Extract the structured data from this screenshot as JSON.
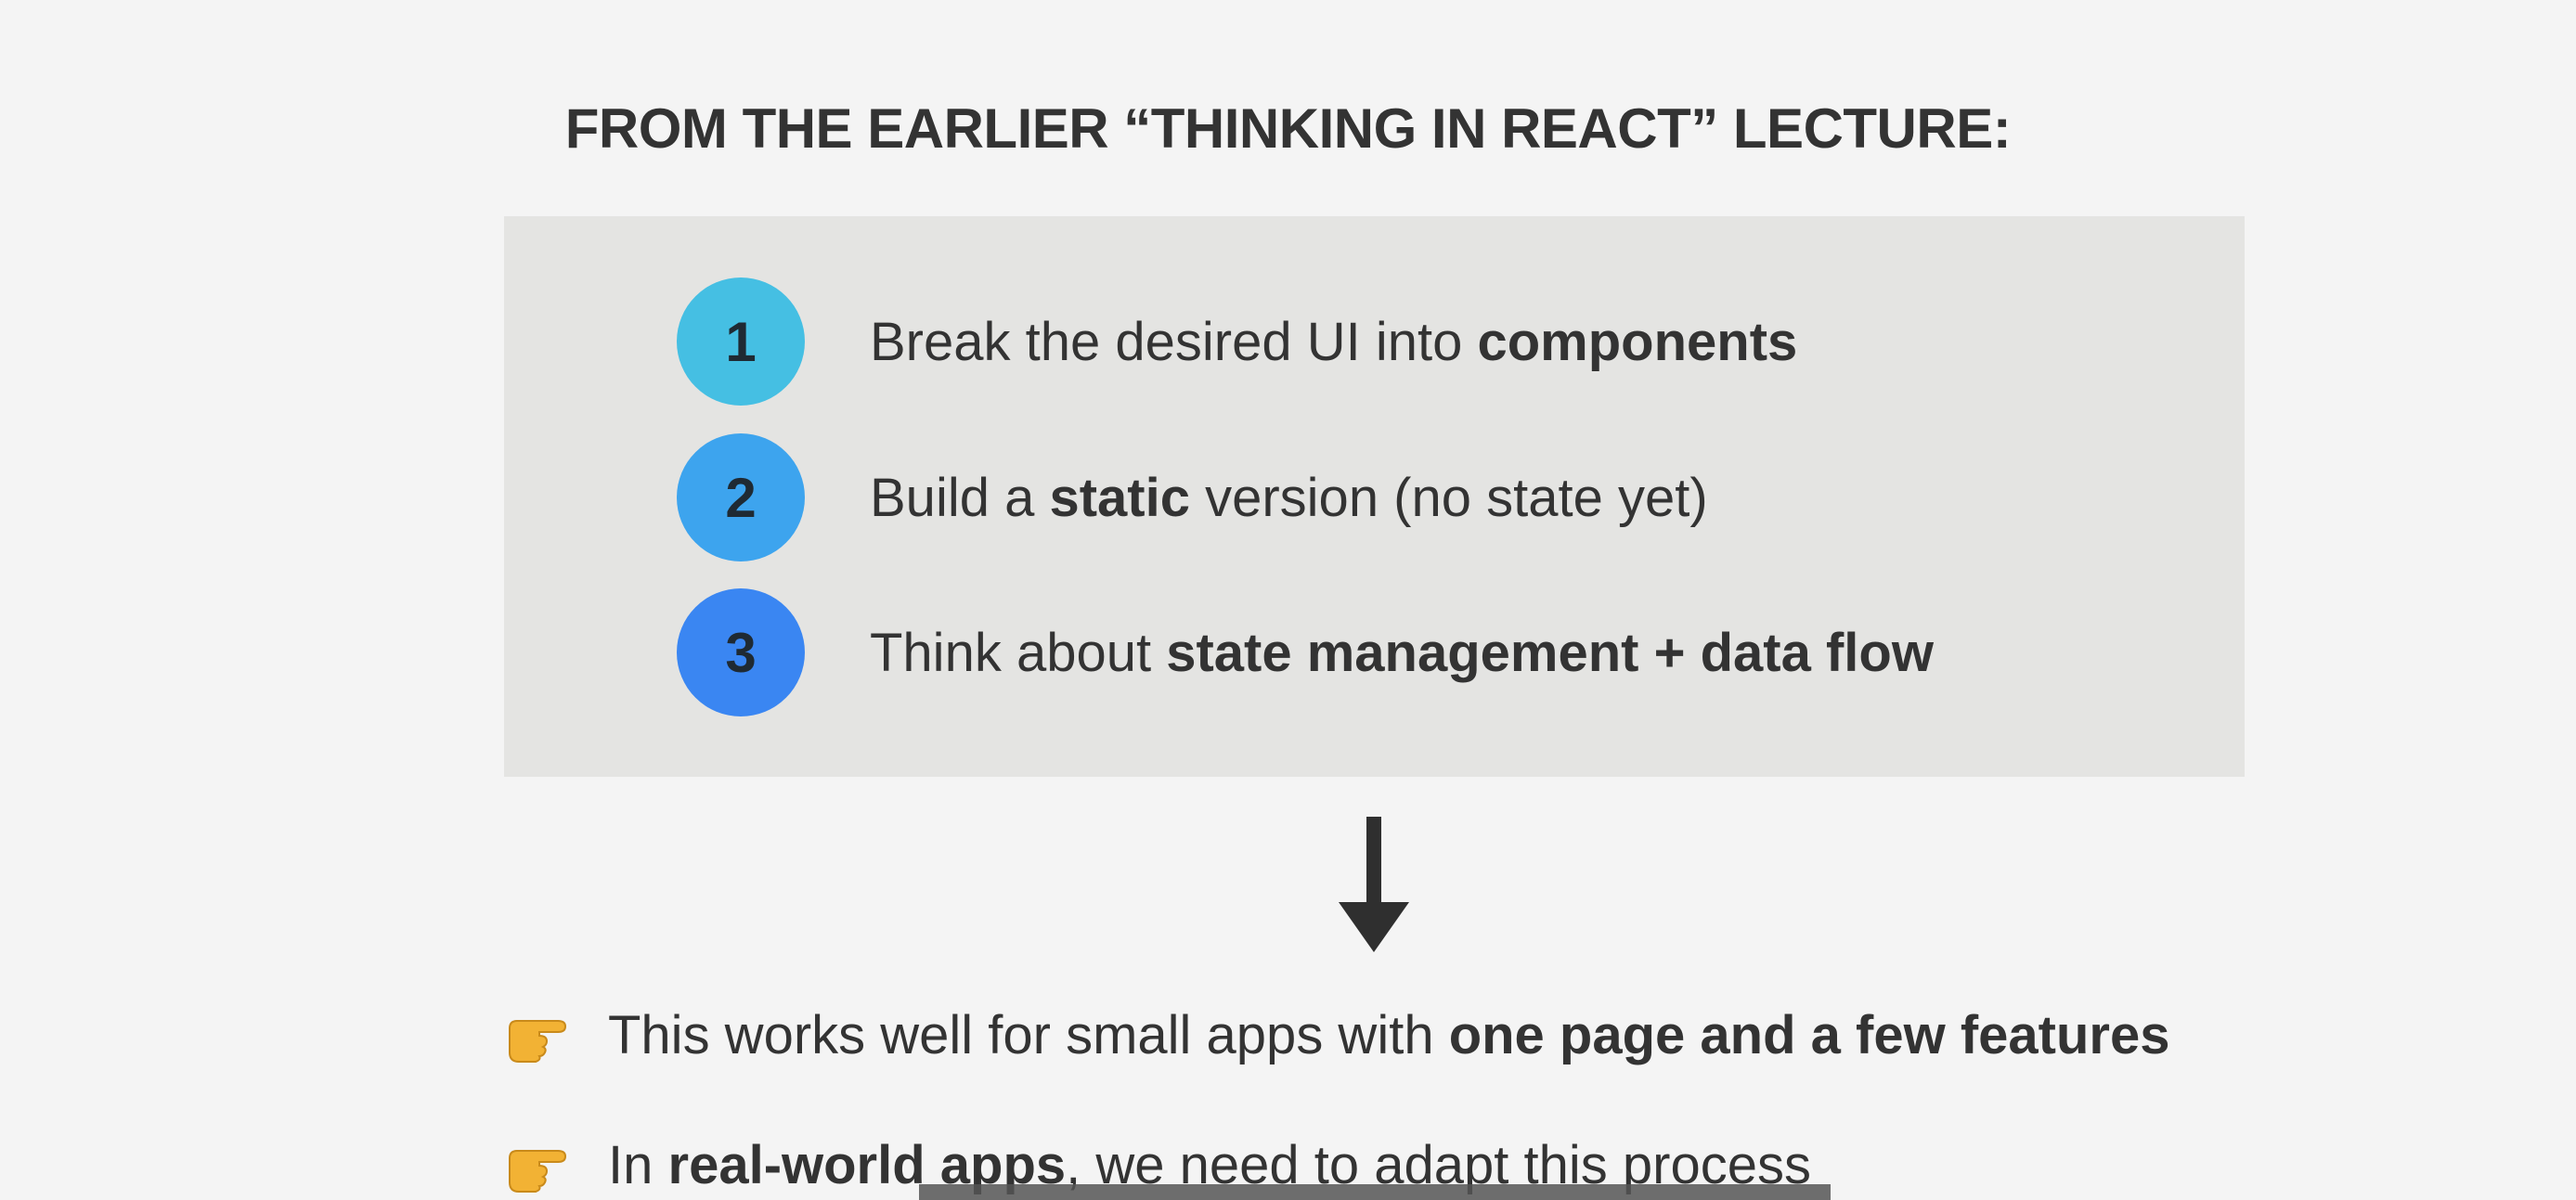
{
  "heading": "FROM THE EARLIER “THINKING IN REACT” LECTURE:",
  "steps": [
    {
      "number": "1",
      "text_before": "Break the desired UI into ",
      "text_bold": "components",
      "text_after": "",
      "color": "#45bfe3"
    },
    {
      "number": "2",
      "text_before": "Build a ",
      "text_bold": "static",
      "text_after": " version (no state yet)",
      "color": "#3da4ee"
    },
    {
      "number": "3",
      "text_before": "Think about ",
      "text_bold": "state management + data flow",
      "text_after": "",
      "color": "#3a86f2"
    }
  ],
  "arrow_icon": "arrow-down-icon",
  "bullets": [
    {
      "icon": "pointing-hand-icon",
      "text_before": "This works well for small apps with ",
      "text_bold": "one page and a few features",
      "text_after": ""
    },
    {
      "icon": "pointing-hand-icon",
      "text_before": "In ",
      "text_bold": "real-world apps",
      "text_after": ", we need to adapt this process"
    }
  ],
  "colors": {
    "background": "#f4f4f4",
    "box": "#e4e4e2",
    "text": "#333333",
    "hand": "#f2b234"
  }
}
